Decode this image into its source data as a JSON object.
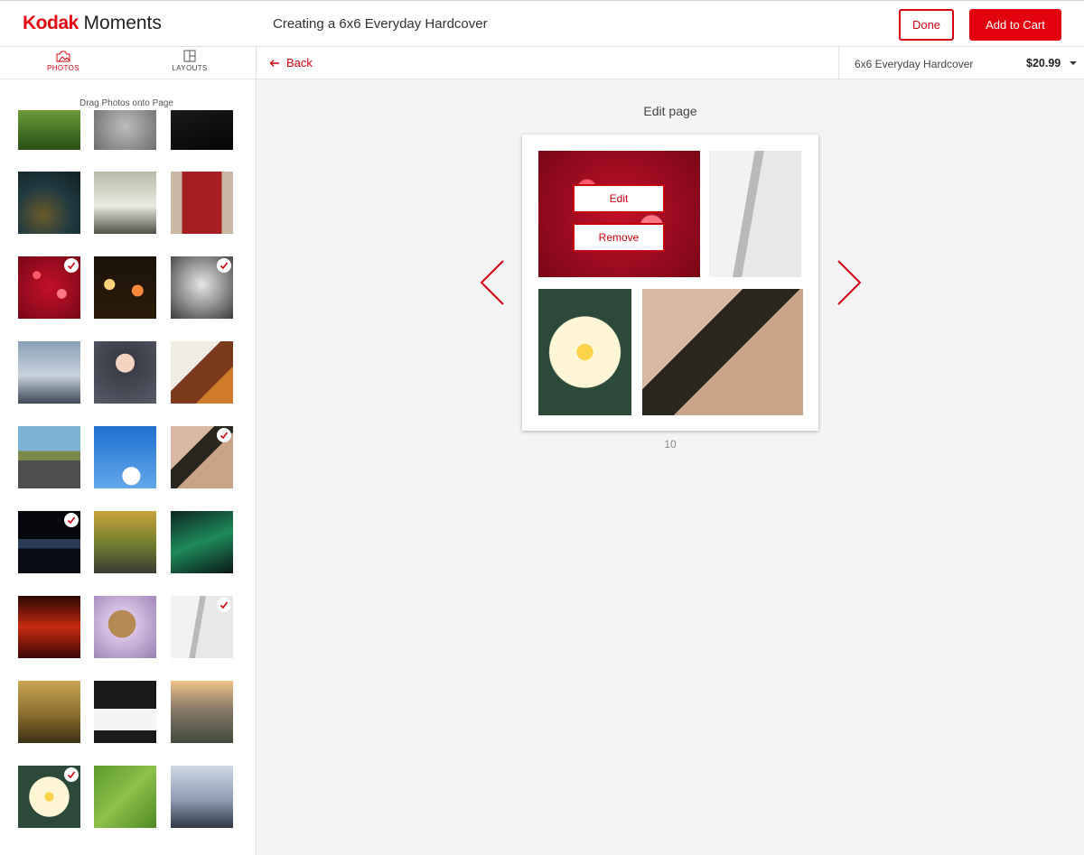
{
  "app": {
    "brand": "Kodak",
    "product": "Moments",
    "project_title": "Creating a 6x6 Everyday Hardcover",
    "done_label": "Done",
    "add_to_cart_label": "Add to Cart",
    "accent_color": "#e3000f"
  },
  "sidebar": {
    "tabs": [
      {
        "label": "PHOTOS",
        "icon": "photos-icon",
        "active": true
      },
      {
        "label": "LAYOUTS",
        "icon": "layouts-icon",
        "active": false
      }
    ],
    "hint": "Drag Photos onto Page",
    "photos": [
      {
        "subject": "dandelion",
        "selected": false
      },
      {
        "subject": "heart-in-sand",
        "selected": false
      },
      {
        "subject": "dark-night",
        "selected": false
      },
      {
        "subject": "autumn-park",
        "selected": false
      },
      {
        "subject": "wind-turbines",
        "selected": false
      },
      {
        "subject": "red-door",
        "selected": false
      },
      {
        "subject": "red-bokeh",
        "selected": true
      },
      {
        "subject": "city-lights-bokeh",
        "selected": false
      },
      {
        "subject": "old-man-portrait",
        "selected": true
      },
      {
        "subject": "seattle-skyline",
        "selected": false
      },
      {
        "subject": "woman-sunglasses",
        "selected": false
      },
      {
        "subject": "steak-dinner",
        "selected": false
      },
      {
        "subject": "open-road",
        "selected": false
      },
      {
        "subject": "blue-sky",
        "selected": false
      },
      {
        "subject": "eye-closeup",
        "selected": true
      },
      {
        "subject": "night-skyline",
        "selected": true
      },
      {
        "subject": "forest-stream",
        "selected": false
      },
      {
        "subject": "aurora",
        "selected": false
      },
      {
        "subject": "red-sunset",
        "selected": false
      },
      {
        "subject": "yorkie-dog",
        "selected": false
      },
      {
        "subject": "book-pencil",
        "selected": true
      },
      {
        "subject": "misty-forest",
        "selected": false
      },
      {
        "subject": "piano-rose",
        "selected": false
      },
      {
        "subject": "valley-sunset",
        "selected": false
      },
      {
        "subject": "water-lily",
        "selected": true
      },
      {
        "subject": "green-grass",
        "selected": false
      },
      {
        "subject": "misty-mountains",
        "selected": false
      }
    ]
  },
  "toolbar": {
    "back_label": "Back",
    "product_name": "6x6 Everyday Hardcover",
    "price": "$20.99"
  },
  "editor": {
    "title": "Edit page",
    "page_number": "10",
    "edit_label": "Edit",
    "remove_label": "Remove",
    "slots": [
      "red-bokeh",
      "book-pencil",
      "water-lily",
      "eye-closeup"
    ]
  }
}
